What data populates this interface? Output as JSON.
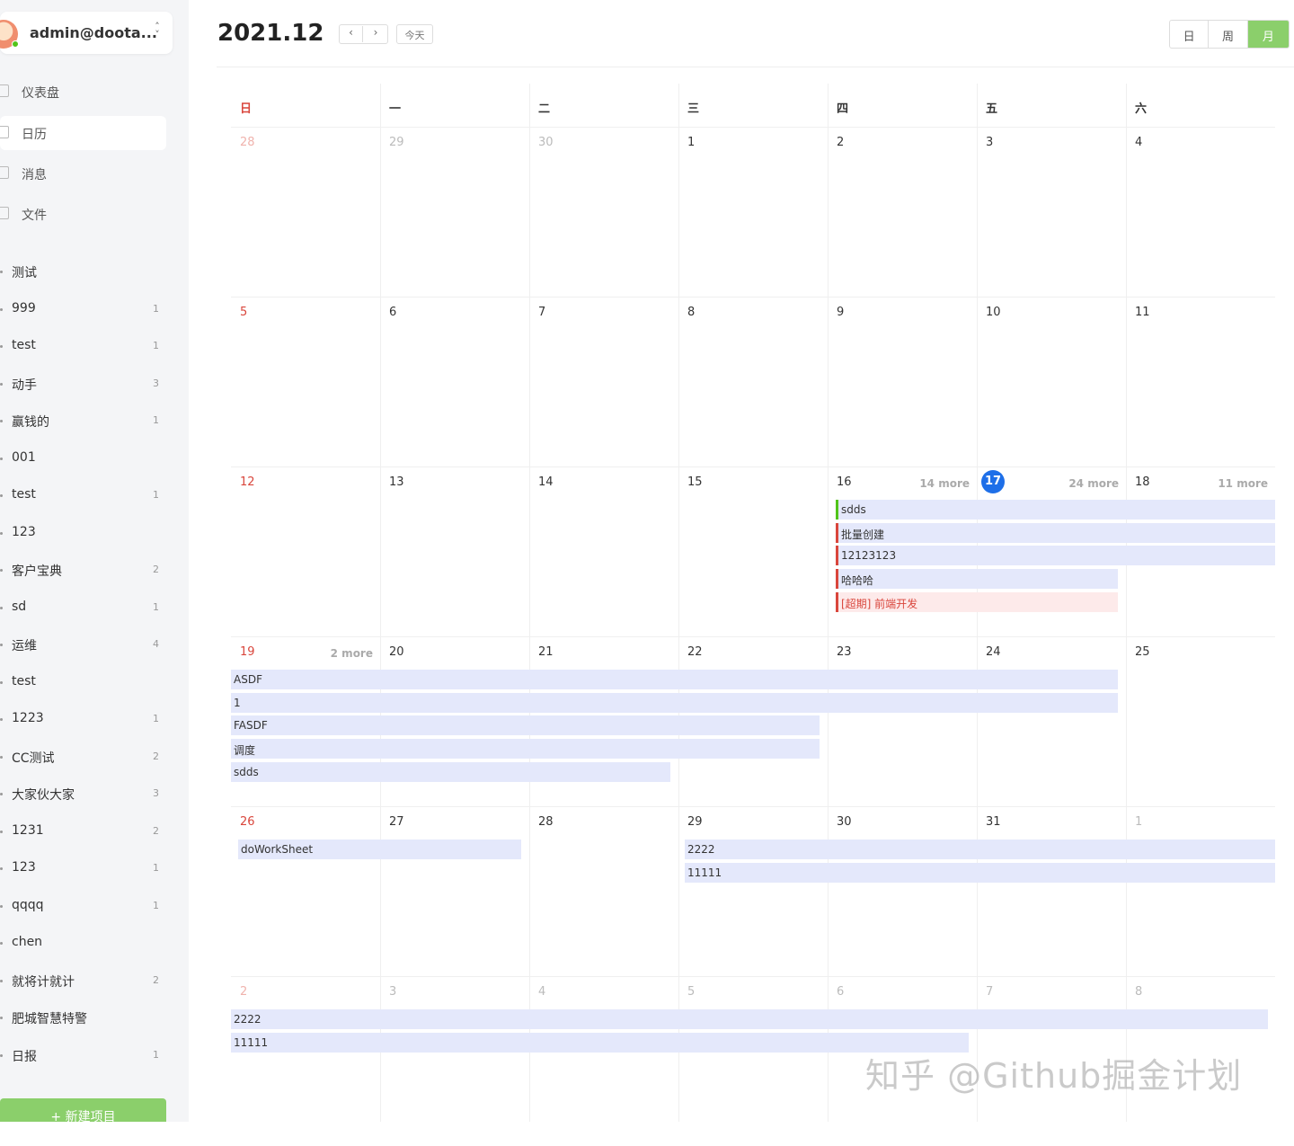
{
  "user": {
    "name": "admin@doota..."
  },
  "menu": [
    {
      "label": "仪表盘",
      "icon": "dashboard-icon"
    },
    {
      "label": "日历",
      "icon": "calendar-icon",
      "active": true
    },
    {
      "label": "消息",
      "icon": "message-icon"
    },
    {
      "label": "文件",
      "icon": "file-icon"
    }
  ],
  "projects": [
    {
      "label": "测试",
      "count": ""
    },
    {
      "label": "999",
      "count": "1"
    },
    {
      "label": "test",
      "count": "1"
    },
    {
      "label": "动手",
      "count": "3"
    },
    {
      "label": "赢钱的",
      "count": "1"
    },
    {
      "label": "001",
      "count": ""
    },
    {
      "label": "test",
      "count": "1"
    },
    {
      "label": "123",
      "count": ""
    },
    {
      "label": "客户宝典",
      "count": "2"
    },
    {
      "label": "sd",
      "count": "1"
    },
    {
      "label": "运维",
      "count": "4"
    },
    {
      "label": "test",
      "count": ""
    },
    {
      "label": "1223",
      "count": "1"
    },
    {
      "label": "CC测试",
      "count": "2"
    },
    {
      "label": "大家伙大家",
      "count": "3"
    },
    {
      "label": "1231",
      "count": "2"
    },
    {
      "label": "123",
      "count": "1"
    },
    {
      "label": "qqqq",
      "count": "1"
    },
    {
      "label": "chen",
      "count": ""
    },
    {
      "label": "就将计就计",
      "count": "2"
    },
    {
      "label": "肥城智慧特警",
      "count": ""
    },
    {
      "label": "日报",
      "count": "1"
    }
  ],
  "new_project_label": "+ 新建项目",
  "header": {
    "month": "2021.12",
    "prev": "‹",
    "next": "›",
    "today": "今天",
    "views": [
      "日",
      "周",
      "月"
    ],
    "active_view": 2
  },
  "weekdays": [
    "日",
    "一",
    "二",
    "三",
    "四",
    "五",
    "六"
  ],
  "weeks": [
    [
      {
        "d": "28",
        "other": true
      },
      {
        "d": "29",
        "other": true
      },
      {
        "d": "30",
        "other": true
      },
      {
        "d": "1"
      },
      {
        "d": "2"
      },
      {
        "d": "3"
      },
      {
        "d": "4"
      }
    ],
    [
      {
        "d": "5"
      },
      {
        "d": "6"
      },
      {
        "d": "7"
      },
      {
        "d": "8"
      },
      {
        "d": "9"
      },
      {
        "d": "10"
      },
      {
        "d": "11"
      }
    ],
    [
      {
        "d": "12"
      },
      {
        "d": "13"
      },
      {
        "d": "14"
      },
      {
        "d": "15"
      },
      {
        "d": "16",
        "more": "14 more"
      },
      {
        "d": "17",
        "today": true,
        "more": "24 more"
      },
      {
        "d": "18",
        "more": "11 more"
      }
    ],
    [
      {
        "d": "19",
        "more": "2 more"
      },
      {
        "d": "20"
      },
      {
        "d": "21"
      },
      {
        "d": "22"
      },
      {
        "d": "23"
      },
      {
        "d": "24"
      },
      {
        "d": "25"
      }
    ],
    [
      {
        "d": "26"
      },
      {
        "d": "27"
      },
      {
        "d": "28"
      },
      {
        "d": "29"
      },
      {
        "d": "30"
      },
      {
        "d": "31"
      },
      {
        "d": "1",
        "other": true
      }
    ],
    [
      {
        "d": "2",
        "other": true
      },
      {
        "d": "3",
        "other": true
      },
      {
        "d": "4",
        "other": true
      },
      {
        "d": "5",
        "other": true
      },
      {
        "d": "6",
        "other": true
      },
      {
        "d": "7",
        "other": true
      },
      {
        "d": "8",
        "other": true
      }
    ]
  ],
  "events": [
    {
      "title": "sdds",
      "week": 2,
      "slot": 0,
      "start": 4,
      "end": 7,
      "border": "#52c41a"
    },
    {
      "title": "批量创建",
      "week": 2,
      "slot": 1,
      "start": 4,
      "end": 7,
      "border": "#d9463c"
    },
    {
      "title": "12123123",
      "week": 2,
      "slot": 2,
      "start": 4,
      "end": 7,
      "border": "#d9463c"
    },
    {
      "title": "哈哈哈",
      "week": 2,
      "slot": 3,
      "start": 4,
      "end": 6,
      "border": "#d9463c"
    },
    {
      "title": "[超期] 前端开发",
      "week": 2,
      "slot": 4,
      "start": 4,
      "end": 6,
      "border": "#d9463c",
      "overdue": true
    },
    {
      "title": "ASDF",
      "week": 3,
      "slot": 0,
      "start": 0,
      "end": 6
    },
    {
      "title": "1",
      "week": 3,
      "slot": 1,
      "start": 0,
      "end": 6
    },
    {
      "title": "FASDF",
      "week": 3,
      "slot": 2,
      "start": 0,
      "end": 4
    },
    {
      "title": "调度",
      "week": 3,
      "slot": 3,
      "start": 0,
      "end": 4
    },
    {
      "title": "sdds",
      "week": 3,
      "slot": 4,
      "start": 0,
      "end": 3
    },
    {
      "title": "doWorkSheet",
      "week": 4,
      "slot": 0,
      "start": 0,
      "end": 2,
      "indent": true
    },
    {
      "title": "2222",
      "week": 4,
      "slot": 0,
      "start": 3,
      "end": 7
    },
    {
      "title": "11111",
      "week": 4,
      "slot": 1,
      "start": 3,
      "end": 7
    },
    {
      "title": "2222",
      "week": 5,
      "slot": 0,
      "start": 0,
      "end": 7,
      "trim": true
    },
    {
      "title": "11111",
      "week": 5,
      "slot": 1,
      "start": 0,
      "end": 5
    }
  ],
  "watermark": "知乎 @Github掘金计划",
  "colors": {
    "accent": "#8bcf6b",
    "today": "#1e6fe8",
    "sunday": "#d9463c",
    "event_bg": "#e4e8fb"
  }
}
